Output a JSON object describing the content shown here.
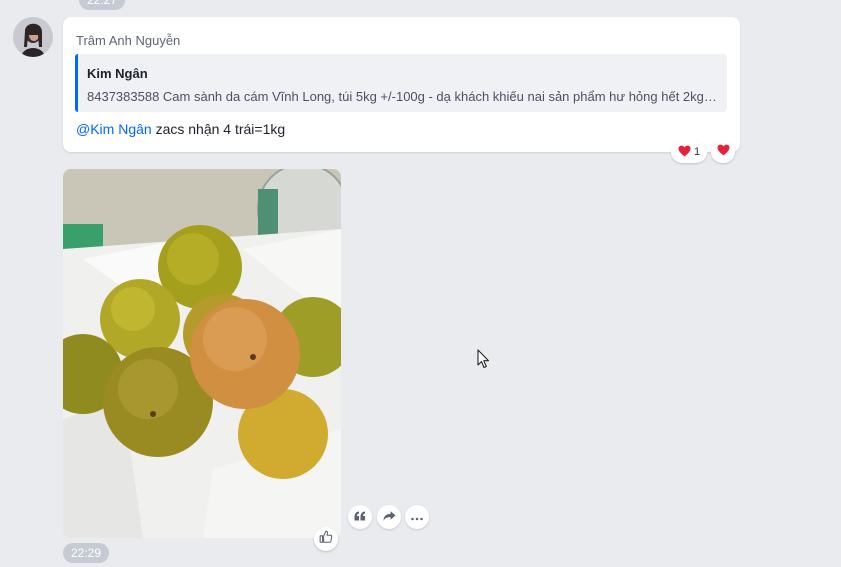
{
  "chat": {
    "prev_time": "22:27",
    "message1": {
      "sender": "Trâm Anh Nguyễn",
      "quote_author": "Kim Ngân",
      "quote_text": "8437383588 Cam sành da cám Vĩnh Long, túi 5kg +/-100g - dạ khách khiếu nai sản phẩm hư hỏng hết 2kg, ...",
      "mention": "@Kim Ngân",
      "text": " zacs nhận 4 trái=1kg",
      "reaction_count": "1"
    },
    "message2": {
      "time": "22:29"
    }
  },
  "icons": {
    "heart": "heart-icon",
    "like": "thumbs-up-icon",
    "quote": "quote-icon",
    "forward": "forward-icon",
    "more": "more-icon"
  },
  "colors": {
    "background": "#e9ebef",
    "accent": "#0068ff",
    "heart": "#e5223a"
  }
}
